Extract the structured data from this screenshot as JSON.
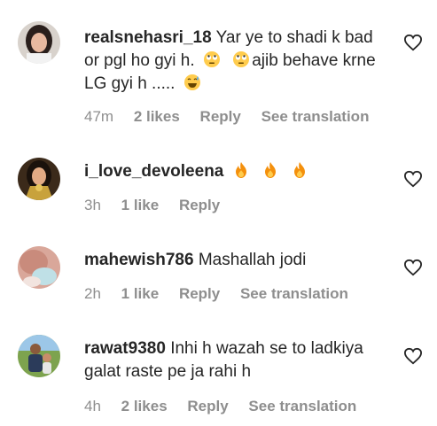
{
  "comments": [
    {
      "username": "realsnehasri_18",
      "text_part1": "Yar ye to shadi k bad or pgl ho gyi h.",
      "text_part2": "ajib behave krne LG gyi h .....",
      "time": "47m",
      "likes": "2 likes",
      "reply": "Reply",
      "translation": "See translation",
      "emoji": [
        "face-with-rolling-eyes-icon",
        "face-with-rolling-eyes-icon",
        "grinning-sweat-icon"
      ]
    },
    {
      "username": "i_love_devoleena",
      "text_part1": "",
      "time": "3h",
      "likes": "1 like",
      "reply": "Reply",
      "emoji": [
        "fire-icon",
        "fire-icon",
        "fire-icon"
      ]
    },
    {
      "username": "mahewish786",
      "text_part1": "Mashallah jodi",
      "time": "2h",
      "likes": "1 like",
      "reply": "Reply",
      "translation": "See translation"
    },
    {
      "username": "rawat9380",
      "text_part1": "Inhi h wazah se to ladkiya galat raste pe ja rahi h",
      "time": "4h",
      "likes": "2 likes",
      "reply": "Reply",
      "translation": "See translation"
    }
  ],
  "colors": {
    "text": "#262626",
    "meta": "#8e8e8e",
    "fire": "#f77f00"
  }
}
